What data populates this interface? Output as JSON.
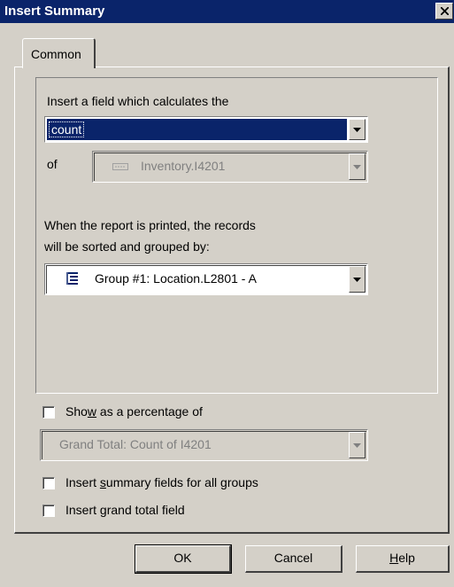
{
  "window": {
    "title": "Insert Summary"
  },
  "tabs": [
    {
      "label": "Common"
    }
  ],
  "summary": {
    "calculates_label": "Insert a field which calculates the",
    "function_value": "count",
    "of_label": "of",
    "field_value": "Inventory.I4201",
    "sorted_label_line1": "When the report is printed, the records",
    "sorted_label_line2": "will be sorted and grouped by:",
    "group_value": "Group #1: Location.L2801 - A"
  },
  "options": {
    "show_percentage": {
      "pre": "Sho",
      "accel": "w",
      "post": " as a percentage of",
      "checked": false
    },
    "percentage_of_value": "Grand Total: Count of I4201",
    "summary_all_groups": {
      "pre": "Insert ",
      "accel": "s",
      "post": "ummary fields for all groups",
      "checked": false
    },
    "grand_total": {
      "pre": "Insert ",
      "accel": "g",
      "post": "rand total field",
      "checked": false
    }
  },
  "buttons": {
    "ok": "OK",
    "cancel": "Cancel",
    "help_accel": "H",
    "help_rest": "elp"
  },
  "colors": {
    "titlebar": "#0a246a",
    "face": "#d4d0c8",
    "highlight": "#0a246a"
  }
}
